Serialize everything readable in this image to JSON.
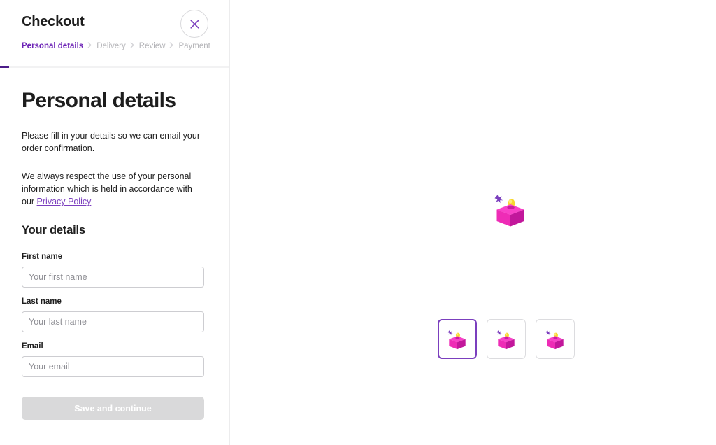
{
  "header": {
    "title": "Checkout",
    "close_icon": "close-icon",
    "breadcrumb": [
      {
        "label": "Personal details",
        "active": true
      },
      {
        "label": "Delivery",
        "active": false
      },
      {
        "label": "Review",
        "active": false
      },
      {
        "label": "Payment",
        "active": false
      }
    ],
    "separator": "›",
    "progress_percent": 4
  },
  "sidebar": {
    "page_title": "Personal details",
    "intro_text": "Please fill in your details so we can email your order confirmation.",
    "privacy_text": "We always respect the use of your personal information which is held in accordance with our ",
    "privacy_link": "Privacy Policy",
    "section_title": "Your details",
    "fields": [
      {
        "label": "First name",
        "placeholder": "Your first name",
        "value": ""
      },
      {
        "label": "Last name",
        "placeholder": "Your last name",
        "value": ""
      },
      {
        "label": "Email",
        "placeholder": "Your email",
        "value": ""
      }
    ],
    "submit_label": "Save and continue",
    "submit_disabled": true
  },
  "product_viewer": {
    "hero_icon": "product-cube-icon",
    "thumbnails": [
      {
        "icon": "product-cube-icon",
        "selected": true
      },
      {
        "icon": "product-cube-icon",
        "selected": false
      },
      {
        "icon": "product-cube-icon",
        "selected": false
      }
    ]
  },
  "colors": {
    "accent_purple": "#7b3fbe",
    "deep_purple": "#4c1d89",
    "muted_gray": "#b4b4b8",
    "border_gray": "#cdcdd1",
    "disabled_gray": "#d9d9da",
    "cube_top": "#f841c8",
    "cube_left": "#ef2bb5",
    "cube_right": "#c2179b",
    "pin_yellow": "#f7d730",
    "sparkle_purple": "#7b3fbe"
  }
}
